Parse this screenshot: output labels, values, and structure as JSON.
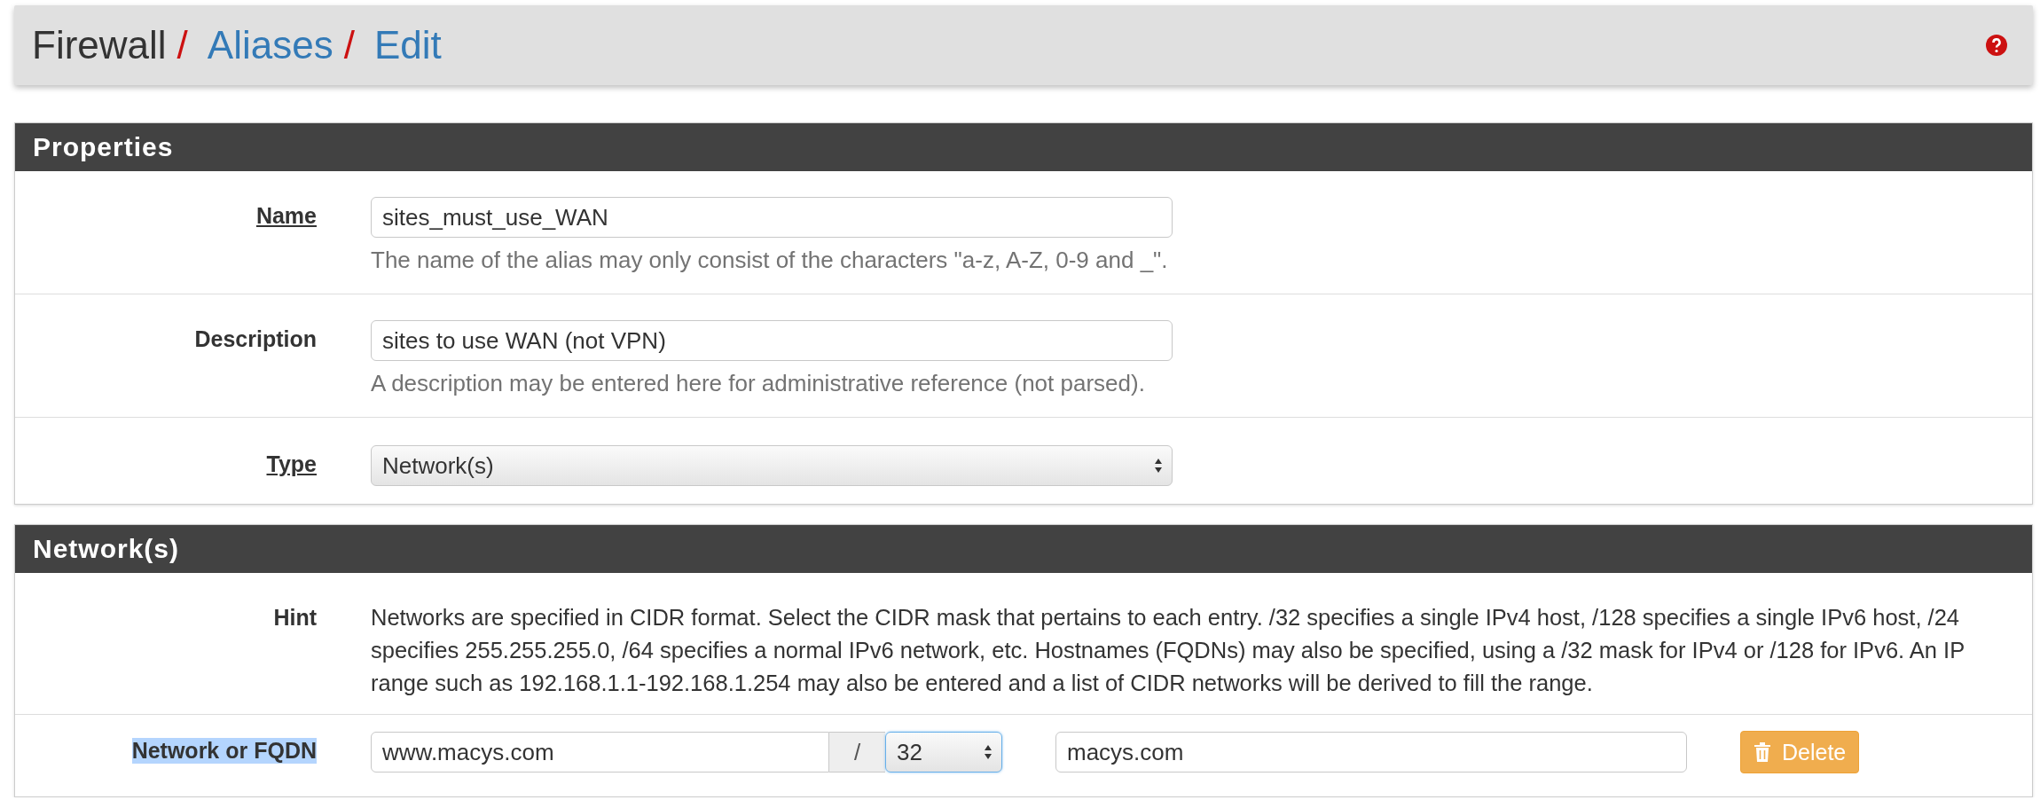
{
  "breadcrumb": [
    {
      "label": "Firewall",
      "link": false,
      "separator": "/"
    },
    {
      "label": "Aliases",
      "link": true,
      "separator": "/"
    },
    {
      "label": "Edit",
      "link": true
    }
  ],
  "properties": {
    "title": "Properties",
    "rows": [
      {
        "kind": "input",
        "label": "Name",
        "required": true,
        "value": "sites_must_use_WAN",
        "help": "The name of the alias may only consist of the characters \"a-z, A-Z, 0-9 and _\"."
      },
      {
        "kind": "input",
        "label": "Description",
        "required": false,
        "value": "sites to use WAN (not VPN)",
        "help": "A description may be entered here for administrative reference (not parsed)."
      },
      {
        "kind": "select",
        "label": "Type",
        "required": true,
        "value": "Network(s)"
      }
    ]
  },
  "networks": {
    "title": "Network(s)",
    "hint": {
      "label": "Hint",
      "text": "Networks are specified in CIDR format. Select the CIDR mask that pertains to each entry. /32 specifies a single IPv4 host, /128 specifies a single IPv6 host, /24 specifies 255.255.255.0, /64 specifies a normal IPv6 network, etc. Hostnames (FQDNs) may also be specified, using a /32 mask for IPv4 or /128 for IPv6. An IP range such as 192.168.1.1-192.168.1.254 may also be entered and a list of CIDR networks will be derived to fill the range."
    },
    "entries": [
      {
        "label": "Network or FQDN",
        "highlighted": true,
        "address": "www.macys.com",
        "separator": "/",
        "mask": "32",
        "mask_focused": true,
        "description": "macys.com",
        "delete": "Delete"
      }
    ]
  }
}
